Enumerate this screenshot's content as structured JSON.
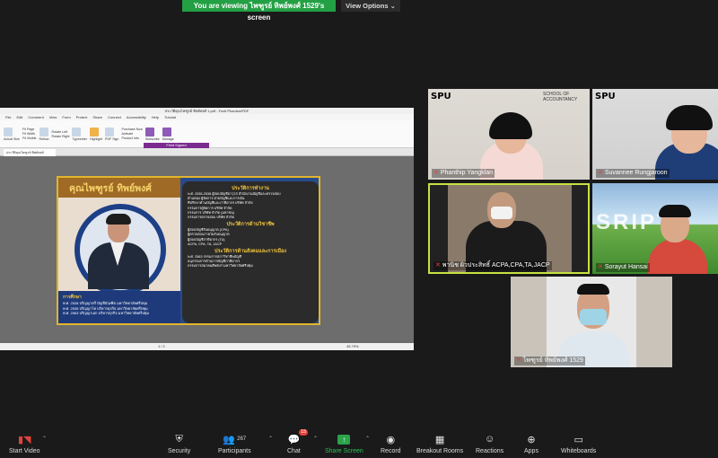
{
  "banner": {
    "viewing_text": "You are viewing ไพฑูรย์ ทิพย์พงศ์ 1529's screen",
    "view_options": "View Options ⌄"
  },
  "shared_screen": {
    "window_title": "ประวัติคุณไพฑูรย์ ทิพย์พงศ์ 1.pdf - Foxit PhantomPDF",
    "menu": [
      "File",
      "Edit",
      "Comment",
      "View",
      "Form",
      "Protect",
      "Share",
      "Connect",
      "Accessibility",
      "Help",
      "Tutorial"
    ],
    "ribbon_labels": [
      "Actual Size",
      "Fit Page",
      "Fit Width",
      "Fit Visible",
      "Reflow",
      "Rotate Left",
      "Rotate Right",
      "Typewriter",
      "Highlight",
      "PDF Sign",
      "Purchase Now",
      "Activate",
      "Product Info",
      "Subscribe",
      "Manage"
    ],
    "form_tag": "Field Signed",
    "tab_label": "ประวัติคุณไพฑูรย์ ทิพย์พงศ์",
    "page_indicator": "1 / 2",
    "zoom": "45.79%",
    "slide": {
      "name": "คุณไพฑูรย์ ทิพย์พงศ์",
      "education_heading": "การศึกษา",
      "education": [
        "พ.ศ. 2528 ปริญญาตรี บัญชีบัณฑิต มหาวิทยาลัยศรีปทุม",
        "พ.ศ. 2535 ปริญญาโท บริหารธุรกิจ มหาวิทยาลัยศรีปทุม",
        "พ.ศ. 2563 ปริญญาเอก บริหารธุรกิจ มหาวิทยาลัยศรีปทุม"
      ],
      "work_heading": "ประวัติการทำงาน",
      "work": [
        "พ.ศ. 2535-2538 ผู้สอบบัญชีอาวุโส สำนักงานบัญชีและตรวจสอบ",
        "ตำแหน่ง ผู้จัดการ ฝ่ายบัญชีและการเงิน",
        "ที่ปรึกษาด้านบัญชีและภาษีอากร บริษัท จำกัด",
        "กรรมการผู้จัดการ บริษัท จำกัด",
        "กรรมการ บริษัท จำกัด (มหาชน)",
        "กรรมการตรวจสอบ บริษัท จำกัด"
      ],
      "professional_heading": "ประวัติการด้านวิชาชีพ",
      "professional": [
        "ผู้สอบบัญชีรับอนุญาต (CPA)",
        "ผู้ตรวจสอบภายในรับอนุญาต",
        "ผู้สอบบัญชีภาษีอากร (TA)",
        "ACPA, CPA, TA, JACP"
      ],
      "social_heading": "ประวัติการด้านสังคมและการเมือง",
      "social": [
        "พ.ศ. 2563 กรรมการสภาวิชาชีพบัญชี",
        "อนุกรรมการด้านการบัญชีภาษีอากร",
        "กรรมการสมาคมศิษย์เก่ามหาวิทยาลัยศรีปทุม"
      ]
    }
  },
  "participants": [
    {
      "name": "Phanthip Yangklan",
      "muted": true
    },
    {
      "name": "Suvannee Rungjaroon",
      "muted": true
    },
    {
      "name": "พานิช ผิวประสิทธิ์ ACPA,CPA,TA,JACP",
      "muted": true,
      "active_speaker": true
    },
    {
      "name": "Sorayut Hansai",
      "muted": true
    },
    {
      "name": "ไพฑูรย์ ทิพย์พงศ์ 1529",
      "muted": true
    }
  ],
  "tile_brand": {
    "spu": "SPU",
    "school": "SCHOOL OF ACCOUNTANCY",
    "sriptu": "SRIPTU"
  },
  "toolbar": {
    "start_video": "Start Video",
    "security": "Security",
    "participants": "Participants",
    "participant_count": "267",
    "chat": "Chat",
    "chat_badge": "15",
    "share_screen": "Share Screen",
    "record": "Record",
    "breakout_rooms": "Breakout Rooms",
    "reactions": "Reactions",
    "apps": "Apps",
    "whiteboards": "Whiteboards"
  },
  "colors": {
    "banner_green": "#23a044",
    "active_speaker_border": "#c6e240",
    "muted_red": "#e0433a",
    "share_green": "#2aa34a"
  }
}
